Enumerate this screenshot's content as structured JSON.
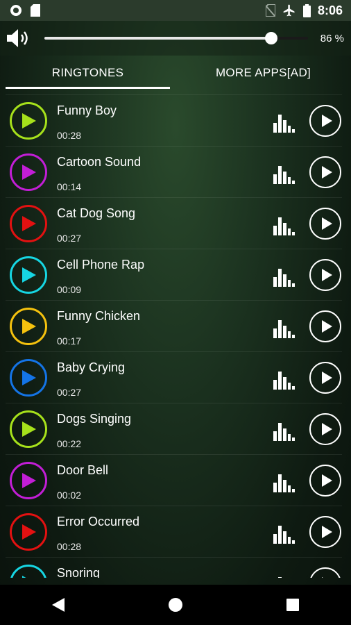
{
  "status_bar": {
    "time": "8:06",
    "icons_left": [
      "record-icon",
      "sd-card-icon"
    ],
    "icons_right": [
      "no-sim-icon",
      "airplane-mode-icon",
      "battery-icon"
    ]
  },
  "volume": {
    "percent_label": "86 %",
    "level": 0.86
  },
  "tabs": [
    {
      "label": "RINGTONES",
      "active": true
    },
    {
      "label": "MORE APPS[AD]",
      "active": false
    }
  ],
  "ringtones": [
    {
      "title": "Funny Boy",
      "duration": "00:28",
      "color": "#a6e11b"
    },
    {
      "title": "Cartoon Sound",
      "duration": "00:14",
      "color": "#c21ed6"
    },
    {
      "title": "Cat Dog Song",
      "duration": "00:27",
      "color": "#e31111"
    },
    {
      "title": "Cell Phone Rap",
      "duration": "00:09",
      "color": "#16d6e3"
    },
    {
      "title": "Funny Chicken",
      "duration": "00:17",
      "color": "#f5c20e"
    },
    {
      "title": "Baby Crying",
      "duration": "00:27",
      "color": "#1474e6"
    },
    {
      "title": "Dogs Singing",
      "duration": "00:22",
      "color": "#a6e11b"
    },
    {
      "title": "Door Bell",
      "duration": "00:02",
      "color": "#c21ed6"
    },
    {
      "title": "Error Occurred",
      "duration": "00:28",
      "color": "#e31111"
    },
    {
      "title": "Snoring",
      "duration": "",
      "color": "#16d6e3"
    }
  ],
  "nav": [
    "back-icon",
    "home-icon",
    "recents-icon"
  ]
}
